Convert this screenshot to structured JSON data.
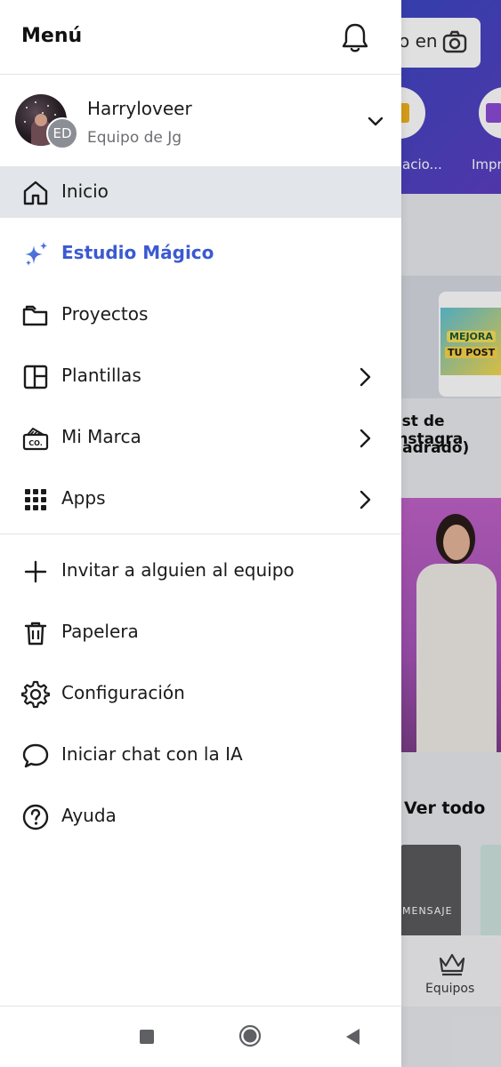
{
  "menu": {
    "title": "Menú"
  },
  "user": {
    "name": "Harryloveer",
    "team": "Equipo de Jg",
    "initials": "ED"
  },
  "nav_items": [
    {
      "label": "Inicio",
      "icon": "home-icon",
      "active": true
    },
    {
      "label": "Estudio Mágico",
      "icon": "sparkle-icon"
    },
    {
      "label": "Proyectos",
      "icon": "folder-icon"
    },
    {
      "label": "Plantillas",
      "icon": "template-icon",
      "has_chevron": true
    },
    {
      "label": "Mi Marca",
      "icon": "brand-icon",
      "has_chevron": true
    },
    {
      "label": "Apps",
      "icon": "apps-grid-icon",
      "has_chevron": true
    }
  ],
  "secondary_items": [
    {
      "label": "Invitar a alguien al equipo",
      "icon": "plus-icon"
    },
    {
      "label": "Papelera",
      "icon": "trash-icon"
    },
    {
      "label": "Configuración",
      "icon": "gear-icon"
    },
    {
      "label": "Iniciar chat con la IA",
      "icon": "chat-bubble-icon"
    },
    {
      "label": "Ayuda",
      "icon": "help-icon"
    }
  ],
  "background": {
    "search_text": "o en",
    "circle_label_1": "acio...",
    "circle_label_2": "Impr",
    "post_text_1": "MEJORA",
    "post_text_2": "TU POST",
    "caption_line_1": "ost de Instagra",
    "caption_line_2": "uadrado)",
    "ver_todo": "Ver todo",
    "thumb_text": "MENSAJE",
    "nav_label": "Equipos"
  },
  "colors": {
    "accent": "#3b5ad0",
    "active_bg": "#e2e5e9",
    "header_gradient_start": "#2c5fd0",
    "header_gradient_end": "#5b3ec1"
  }
}
